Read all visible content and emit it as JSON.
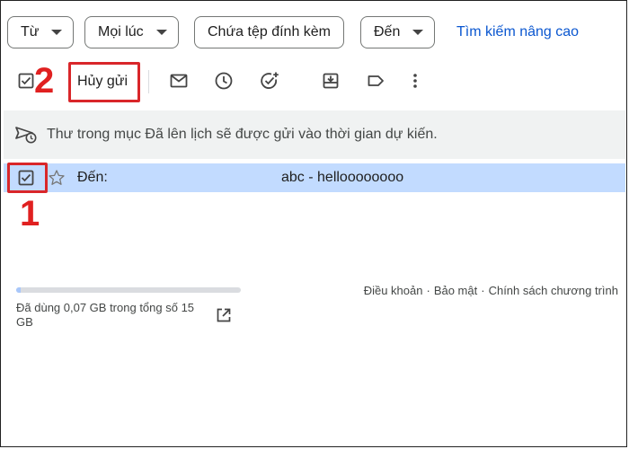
{
  "filters": {
    "from_label": "Từ",
    "time_label": "Mọi lúc",
    "attachment_label": "Chứa tệp đính kèm",
    "to_label": "Đến",
    "advanced_search": "Tìm kiếm nâng cao"
  },
  "toolbar": {
    "unsend_label": "Hủy gửi",
    "icons": [
      "checkbox-icon",
      "mail-icon",
      "clock-icon",
      "add-task-icon",
      "move-to-icon",
      "label-icon",
      "more-vert-icon"
    ]
  },
  "annotations": {
    "step1": "1",
    "step2": "2",
    "highlight_color": "#d9262a"
  },
  "banner": {
    "text": "Thư trong mục Đã lên lịch sẽ được gửi vào thời gian dự kiến."
  },
  "message": {
    "to_prefix": "Đến:",
    "subject": "abc - helloooooooo",
    "selected": true,
    "row_color": "#c2dbff"
  },
  "footer": {
    "storage_text": "Đã dùng 0,07 GB trong tổng số 15 GB",
    "storage_fraction": 0.005,
    "links": [
      "Điều khoản",
      "Bảo mật",
      "Chính sách chương trình"
    ]
  }
}
